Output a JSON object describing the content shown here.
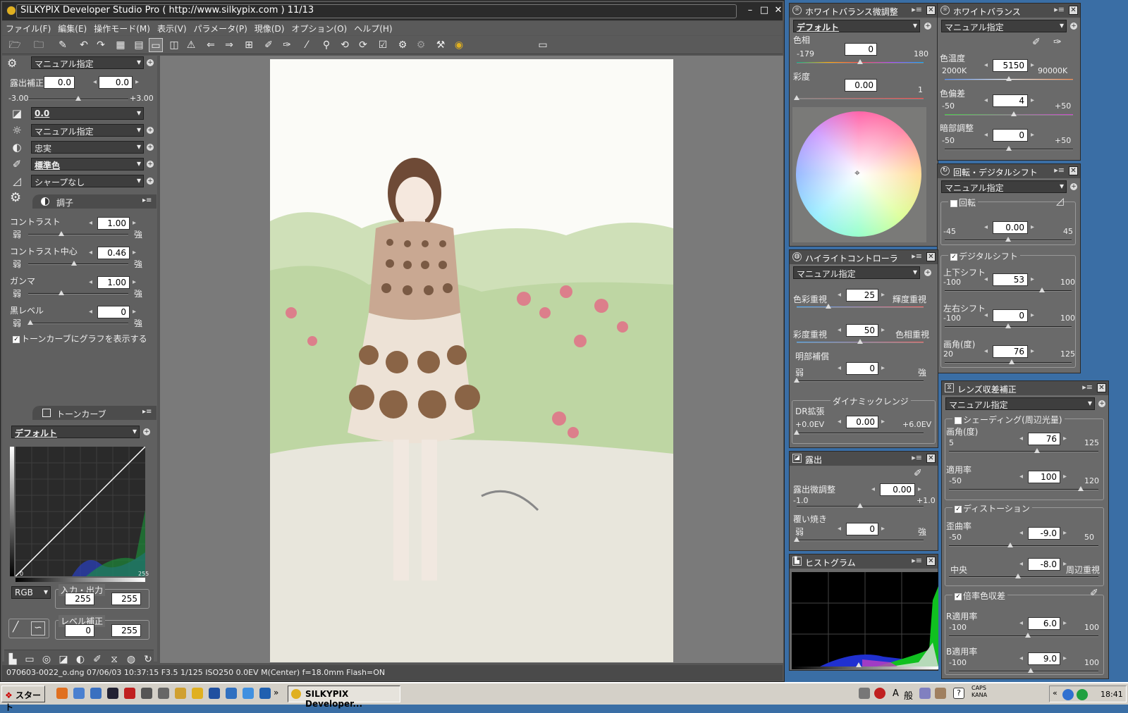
{
  "window": {
    "title": "SILKYPIX Developer Studio Pro ( http://www.silkypix.com )  11/13"
  },
  "menu": [
    "ファイル(F)",
    "編集(E)",
    "操作モード(M)",
    "表示(V)",
    "パラメータ(P)",
    "現像(D)",
    "オプション(O)",
    "ヘルプ(H)"
  ],
  "left": {
    "preset": "マニュアル指定",
    "exposure_label": "露出補正",
    "exposure_val1": "0.0",
    "exposure_val2": "0.0",
    "exposure_min": "-3.00",
    "exposure_max": "+3.00",
    "exposure_level": 0.5,
    "rows": [
      {
        "icon": "exposure-icon",
        "value": "0.0",
        "bold": true
      },
      {
        "icon": "white-balance-icon",
        "value": "マニュアル指定",
        "bold": false
      },
      {
        "icon": "tone-icon",
        "value": "忠実",
        "bold": false
      },
      {
        "icon": "color-icon",
        "value": "標準色",
        "bold": true
      },
      {
        "icon": "sharpness-icon",
        "value": "シャープなし",
        "bold": false
      }
    ],
    "tone_title": "調子",
    "tone": [
      {
        "label": "コントラスト",
        "value": "1.00",
        "level": 0.33
      },
      {
        "label": "コントラスト中心",
        "value": "0.46",
        "level": 0.46
      },
      {
        "label": "ガンマ",
        "value": "1.00",
        "level": 0.33
      },
      {
        "label": "黒レベル",
        "value": "0",
        "level": 0.02
      }
    ],
    "weak": "弱",
    "strong": "強",
    "tone_curve_check": "トーンカーブにグラフを表示する",
    "curve_title": "トーンカーブ",
    "curve_preset": "デフォルト",
    "curve_in_min": "0",
    "curve_in_max": "255",
    "channel": "RGB",
    "io_label": "入力・出力",
    "io_in": "255",
    "io_out": "255",
    "level_label": "レベル補正",
    "level_min": "0",
    "level_max": "255"
  },
  "status": {
    "text": "070603-0022_o.dng 07/06/03 10:37:15 F3.5 1/125 ISO250  0.0EV M(Center) f=18.0mm Flash=ON"
  },
  "wbfine": {
    "title": "ホワイトバランス微調整",
    "preset": "デフォルト",
    "hue_label": "色相",
    "hue_value": "0",
    "hue_min": "-179",
    "hue_max": "180",
    "hue_level": 0.5,
    "sat_label": "彩度",
    "sat_value": "0.00",
    "sat_max": "1",
    "sat_level": 0.0
  },
  "wb": {
    "title": "ホワイトバランス",
    "preset": "マニュアル指定",
    "temp_label": "色温度",
    "temp_value": "5150",
    "temp_min": "2000K",
    "temp_max": "90000K",
    "temp_level": 0.5,
    "tint_label": "色偏差",
    "tint_value": "4",
    "tint_min": "-50",
    "tint_max": "+50",
    "tint_level": 0.54,
    "shadow_label": "暗部調整",
    "shadow_value": "0",
    "shadow_min": "-50",
    "shadow_max": "+50",
    "shadow_level": 0.5
  },
  "rot": {
    "title": "回転・デジタルシフト",
    "preset": "マニュアル指定",
    "rotate_label": "回転",
    "rotate_value": "0.00",
    "rotate_min": "-45",
    "rotate_max": "45",
    "rotate_level": 0.5,
    "shift_label": "デジタルシフト",
    "ud_label": "上下シフト",
    "ud_value": "53",
    "ud_min": "-100",
    "ud_max": "100",
    "ud_level": 0.765,
    "lr_label": "左右シフト",
    "lr_value": "0",
    "lr_min": "-100",
    "lr_max": "100",
    "lr_level": 0.5,
    "angle_label": "画角(度)",
    "angle_value": "76",
    "angle_min": "20",
    "angle_max": "125",
    "angle_level": 0.53
  },
  "hl": {
    "title": "ハイライトコントローラ",
    "preset": "マニュアル指定",
    "a_left": "色彩重視",
    "a_right": "輝度重視",
    "a_value": "25",
    "a_level": 0.25,
    "b_left": "彩度重視",
    "b_right": "色相重視",
    "b_value": "50",
    "b_level": 0.5,
    "c_label": "明部補償",
    "c_value": "0",
    "c_level": 0.0,
    "weak": "弱",
    "strong": "強",
    "dr_group": "ダイナミックレンジ",
    "dr_label": "DR拡張",
    "dr_value": "0.00",
    "dr_min": "+0.0EV",
    "dr_max": "+6.0EV",
    "dr_level": 0.0
  },
  "exp": {
    "title": "露出",
    "fine_label": "露出微調整",
    "fine_value": "0.00",
    "fine_min": "-1.0",
    "fine_max": "+1.0",
    "fine_level": 0.5,
    "burn_label": "覆い焼き",
    "burn_value": "0",
    "burn_level": 0.0,
    "weak": "弱",
    "strong": "強"
  },
  "hist": {
    "title": "ヒストグラム"
  },
  "lens": {
    "title": "レンズ収差補正",
    "preset": "マニュアル指定",
    "shading_label": "シェーディング(周辺光量)",
    "angle_label": "画角(度)",
    "angle_value": "76",
    "angle_min": "5",
    "angle_max": "125",
    "angle_level": 0.59,
    "apply_label": "適用率",
    "apply_value": "100",
    "apply_min": "-50",
    "apply_max": "120",
    "apply_level": 0.88,
    "dist_label": "ディストーション",
    "dist_rate_label": "歪曲率",
    "dist_value": "-9.0",
    "dist_min": "-50",
    "dist_max": "50",
    "dist_level": 0.41,
    "center_label": "中央",
    "edge_label": "周辺重視",
    "center_value": "-8.0",
    "center_level": 0.46,
    "chrom_label": "倍率色収差",
    "r_label": "R適用率",
    "r_value": "6.0",
    "r_min": "-100",
    "r_max": "100",
    "r_level": 0.53,
    "b_label": "B適用率",
    "b_value": "9.0",
    "b_min": "-100",
    "b_max": "100",
    "b_level": 0.545
  },
  "taskbar": {
    "start": "スタート",
    "task": "SILKYPIX Developer...",
    "ime1": "A",
    "ime2": "般",
    "caps": "CAPS",
    "kana": "KANA",
    "time": "18:41"
  }
}
